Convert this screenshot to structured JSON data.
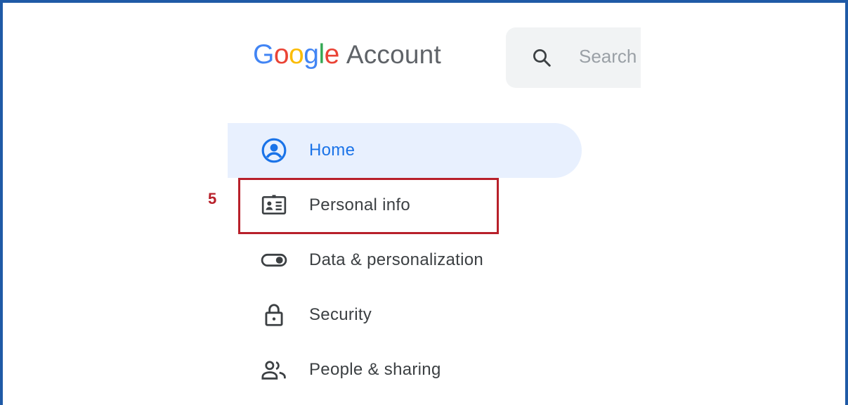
{
  "logo": {
    "google_letters": [
      {
        "char": "G",
        "color": "#4285f4"
      },
      {
        "char": "o",
        "color": "#ea4335"
      },
      {
        "char": "o",
        "color": "#fbbc05"
      },
      {
        "char": "g",
        "color": "#4285f4"
      },
      {
        "char": "l",
        "color": "#34a853"
      },
      {
        "char": "e",
        "color": "#ea4335"
      }
    ],
    "product": "Account"
  },
  "search": {
    "placeholder": "Search",
    "icon": "search-icon"
  },
  "nav": {
    "items": [
      {
        "label": "Home",
        "icon": "account-circle-icon",
        "active": true
      },
      {
        "label": "Personal info",
        "icon": "id-card-icon",
        "active": false
      },
      {
        "label": "Data & personalization",
        "icon": "toggle-icon",
        "active": false
      },
      {
        "label": "Security",
        "icon": "lock-icon",
        "active": false
      },
      {
        "label": "People & sharing",
        "icon": "people-icon",
        "active": false
      }
    ]
  },
  "annotation": {
    "step_number": "5",
    "highlight_color": "#b8202a"
  },
  "colors": {
    "active_bg": "#e8f0fe",
    "active_text": "#1a73e8",
    "frame_border": "#1f5aa6"
  }
}
